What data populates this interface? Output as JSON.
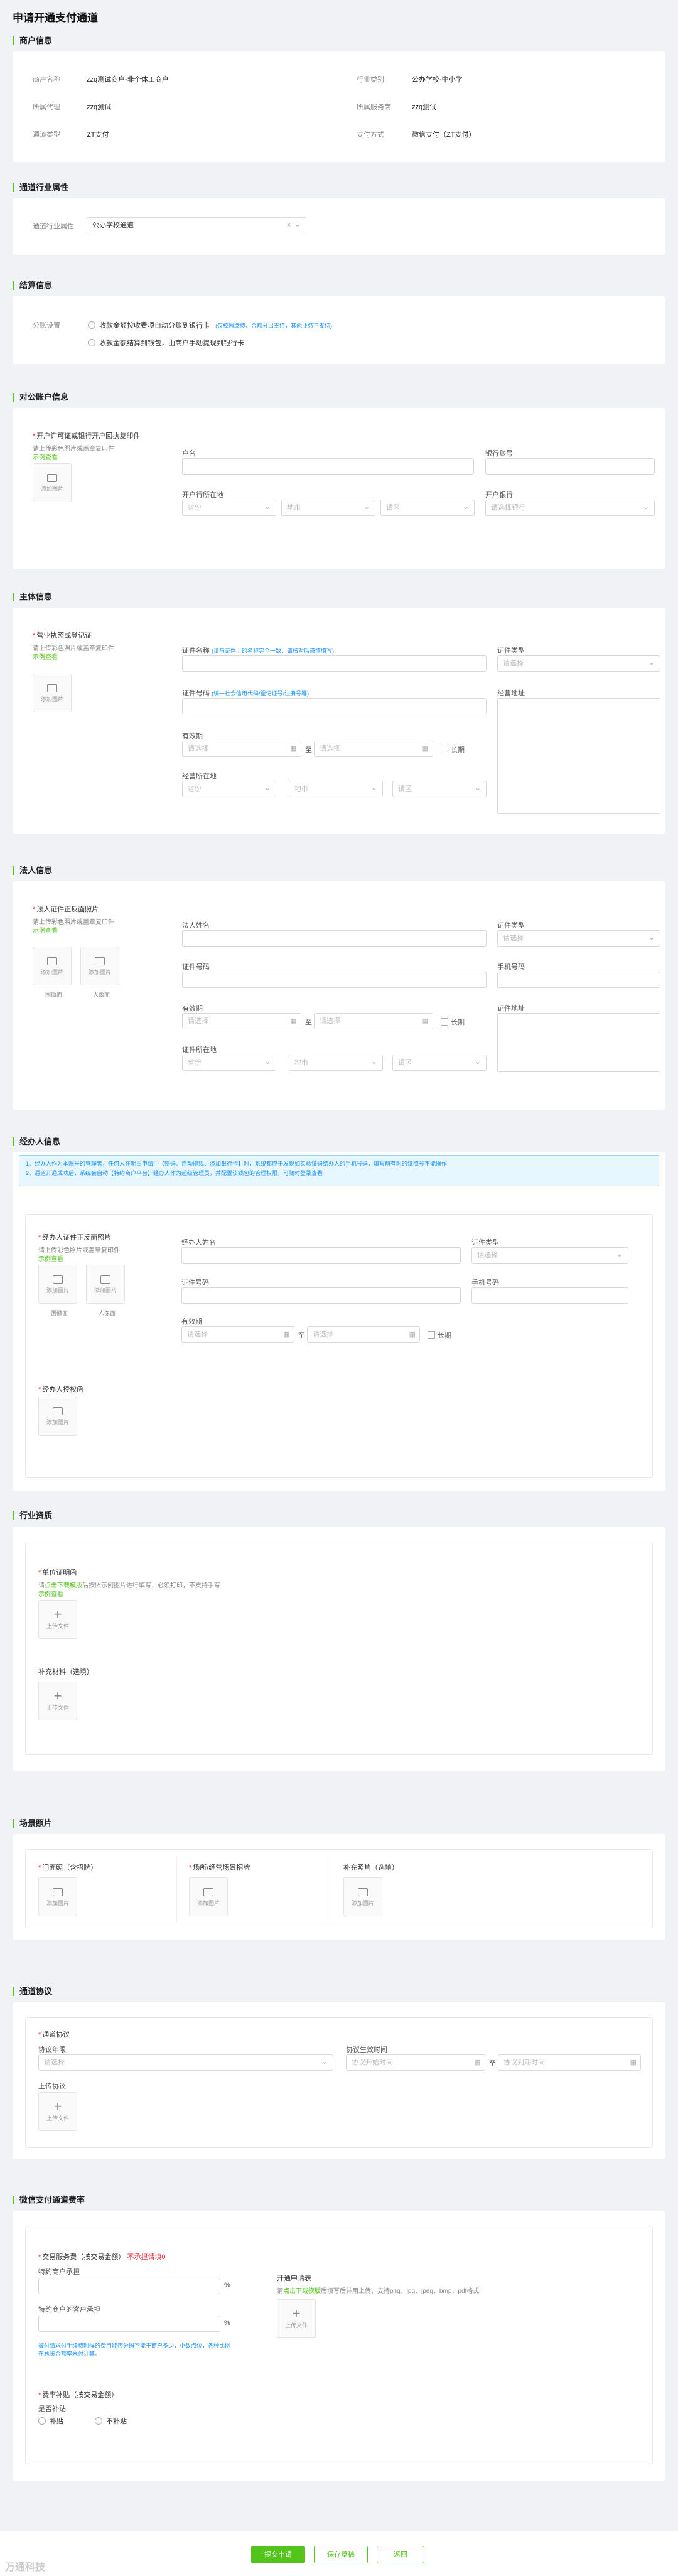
{
  "page_title": "申请开通支付通道",
  "merchant": {
    "title": "商户信息",
    "name_label": "商户名称",
    "name": "zzq测试商户-非个体工商户",
    "industry_label": "行业类别",
    "industry": "公办学校-中小学",
    "belong_label": "所属代理",
    "belong": "zzq测试",
    "service_label": "所属服务商",
    "service": "zzq测试",
    "channel_label": "通道类型",
    "channel": "ZT支付",
    "pay_label": "支付方式",
    "pay": "微信支付（ZT支付）"
  },
  "channel_industry": {
    "title": "通道行业属性",
    "label": "通道行业属性",
    "value": "公办学校通道",
    "clear": "×"
  },
  "settle": {
    "title": "结算信息",
    "label": "分账设置",
    "opt1": "收款金额按收费项自动分账到银行卡",
    "opt1_note": "(仅校园缴费、金额分出支持，其他业务不支持)",
    "opt2": "收款金额结算到钱包，由商户手动提现到银行卡"
  },
  "bank": {
    "title": "对公账户信息",
    "upload_label": "开户许可证或银行开户回执复印件",
    "hint": "请上传彩色照片或盖章复印件",
    "example": "示例查看",
    "add": "添加图片",
    "holder": "户名",
    "account": "银行账号",
    "city": "开户行所在地",
    "bank": "开户银行",
    "province_ph": "省份",
    "city_ph": "地市",
    "district_ph": "请区",
    "bank_ph": "请选择银行"
  },
  "subject": {
    "title": "主体信息",
    "upload_label": "营业执照或登记证",
    "hint": "请上传彩色照片或盖章复印件",
    "example": "示例查看",
    "add": "添加图片",
    "cert_name": "证件名称",
    "cert_name_note": "(请与证件上的名称完全一致，请核对后谨慎填写)",
    "cert_type": "证件类型",
    "cert_type_ph": "请选择",
    "cert_no": "证件号码",
    "cert_no_note": "(统一社会信用代码/登记证号/注册号等)",
    "address": "经营地址",
    "validity": "有效期",
    "select_ph": "请选择",
    "to": "至",
    "long": "长期",
    "biz_location": "经营所在地",
    "province_ph": "省份",
    "city_ph": "地市",
    "district_ph": "请区"
  },
  "legal": {
    "title": "法人信息",
    "upload_label": "法人证件正反面照片",
    "hint": "请上传彩色照片或盖章复印件",
    "example": "示例查看",
    "add": "添加图片",
    "front": "国徽面",
    "back": "人像面",
    "name": "法人姓名",
    "cert_type": "证件类型",
    "cert_type_ph": "请选择",
    "cert_no": "证件号码",
    "phone": "手机号码",
    "validity": "有效期",
    "select_ph": "请选择",
    "to": "至",
    "long": "长期",
    "address": "证件地址",
    "cert_location": "证件所在地",
    "province_ph": "省份",
    "city_ph": "地市",
    "district_ph": "请区"
  },
  "operator": {
    "title": "经办人信息",
    "notice1": "1、经办人作为本账号的管理者，任何人在明白申请中【密码、自动提现、添加银行卡】时，系统都应于发现如实验证码结办人的手机号码，填写前有时的证照号不能操作",
    "notice2": "2、通道开通成功后，系统会自动【特约商户平台】经办人作为超级管理员，并配置该钱包的管理权限，可随时登录查看",
    "upload_label": "经办人证件正反面照片",
    "hint": "请上传彩色照片或盖章复印件",
    "example": "示例查看",
    "add": "添加图片",
    "front": "国徽面",
    "back": "人像面",
    "name": "经办人姓名",
    "cert_type": "证件类型",
    "cert_type_ph": "请选择",
    "cert_no": "证件号码",
    "phone": "手机号码",
    "validity": "有效期",
    "select_ph": "请选择",
    "to": "至",
    "long": "长期",
    "auth_label": "经办人授权函"
  },
  "qualification": {
    "title": "行业资质",
    "unit_label": "单位证明函",
    "unit_hint_pre": "请",
    "unit_hint_link": "点击下载模版",
    "unit_hint_post": "后按照示例图片进行填写，必须打印，不支持手写",
    "example": "示例查看",
    "upload": "上传文件",
    "extra_label": "补充材料（选填）"
  },
  "scene": {
    "title": "场景照片",
    "door": "门面照（含招牌）",
    "shop": "场所/经营场景招牌",
    "extra": "补充照片（选填）",
    "add": "添加图片"
  },
  "agreement": {
    "title": "通道协议",
    "box_label": "通道协议",
    "years": "协议年限",
    "years_ph": "请选择",
    "date_label": "协议生效时间",
    "start_ph": "协议开始时间",
    "to": "至",
    "end_ph": "协议到期时间",
    "upload_label": "上传协议",
    "upload": "上传文件"
  },
  "rate": {
    "title": "微信支付通道费率",
    "fee_label": "交易服务费（按交易金额）",
    "fee_tag": "不承担请填0",
    "merchant_rate": "特约商户承担",
    "pct": "%",
    "customer_rate": "特约商户的客户承担",
    "rate_note": "被付请求付手续费时候的费用能否分摊不能于商户多少，小数点位，各种比例在总货金额率未付计算。",
    "apply_label": "开通申请表",
    "apply_hint_pre": "请",
    "apply_hint_link": "点击下载模版",
    "apply_hint_post": "后填写后并用上传，支持png、jpg、jpeg、bmp、pdf格式",
    "upload": "上传文件",
    "subsidy_label": "费率补贴（按交易金额）",
    "subsidy_q": "是否补贴",
    "yes": "补贴",
    "no": "不补贴"
  },
  "buttons": {
    "submit": "提交申请",
    "draft": "保存草稿",
    "back": "返回"
  },
  "watermark": "万通科技"
}
